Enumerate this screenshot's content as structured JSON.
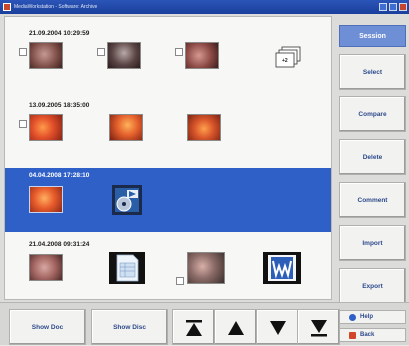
{
  "window": {
    "title": "MediaWorkstation - Software: Archive"
  },
  "sessions": [
    {
      "timestamp": "21.09.2004 10:29:59",
      "extra_count": "+2"
    },
    {
      "timestamp": "13.09.2005 18:35:00"
    },
    {
      "timestamp": "04.04.2008 17:28:10"
    },
    {
      "timestamp": "21.04.2008 09:31:24"
    }
  ],
  "right_panel": {
    "header": "Session",
    "buttons": [
      "Select",
      "Compare",
      "Delete",
      "Comment",
      "Import",
      "Export"
    ],
    "help_label": "Help",
    "back_label": "Back"
  },
  "bottom_bar": {
    "show_doc_label": "Show Doc",
    "show_disc_label": "Show Disc"
  },
  "colors": {
    "selection": "#2f60c8",
    "button_text": "#2d4a8c",
    "header_bg": "#6e8fd6"
  }
}
